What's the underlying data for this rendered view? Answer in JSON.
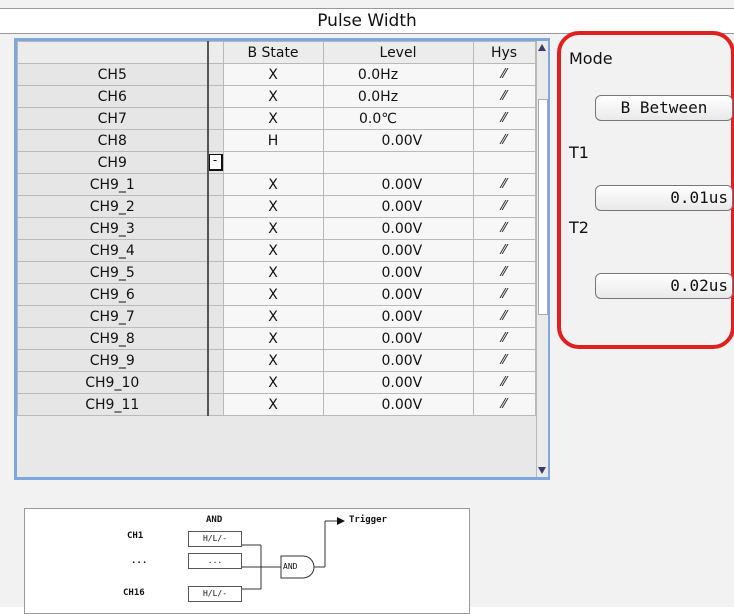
{
  "title": "Pulse Width",
  "table": {
    "headers": {
      "b_state": "B State",
      "level": "Level",
      "hys": "Hys"
    },
    "rows": [
      {
        "name": "CH5",
        "expander": "",
        "bstate": "X",
        "level": "0.0Hz",
        "hys": "⁄⁄",
        "kind": "hz"
      },
      {
        "name": "CH6",
        "expander": "",
        "bstate": "X",
        "level": "0.0Hz",
        "hys": "⁄⁄",
        "kind": "hz"
      },
      {
        "name": "CH7",
        "expander": "",
        "bstate": "X",
        "level": "0.0℃",
        "hys": "⁄⁄",
        "kind": "hz"
      },
      {
        "name": "CH8",
        "expander": "",
        "bstate": "H",
        "level": "0.00V",
        "hys": "⁄⁄",
        "kind": "v"
      },
      {
        "name": "CH9",
        "expander": "-",
        "bstate": "",
        "level": "",
        "hys": "",
        "kind": "v"
      },
      {
        "name": "CH9_1",
        "expander": "",
        "bstate": "X",
        "level": "0.00V",
        "hys": "⁄⁄",
        "kind": "v"
      },
      {
        "name": "CH9_2",
        "expander": "",
        "bstate": "X",
        "level": "0.00V",
        "hys": "⁄⁄",
        "kind": "v"
      },
      {
        "name": "CH9_3",
        "expander": "",
        "bstate": "X",
        "level": "0.00V",
        "hys": "⁄⁄",
        "kind": "v"
      },
      {
        "name": "CH9_4",
        "expander": "",
        "bstate": "X",
        "level": "0.00V",
        "hys": "⁄⁄",
        "kind": "v"
      },
      {
        "name": "CH9_5",
        "expander": "",
        "bstate": "X",
        "level": "0.00V",
        "hys": "⁄⁄",
        "kind": "v"
      },
      {
        "name": "CH9_6",
        "expander": "",
        "bstate": "X",
        "level": "0.00V",
        "hys": "⁄⁄",
        "kind": "v"
      },
      {
        "name": "CH9_7",
        "expander": "",
        "bstate": "X",
        "level": "0.00V",
        "hys": "⁄⁄",
        "kind": "v"
      },
      {
        "name": "CH9_8",
        "expander": "",
        "bstate": "X",
        "level": "0.00V",
        "hys": "⁄⁄",
        "kind": "v"
      },
      {
        "name": "CH9_9",
        "expander": "",
        "bstate": "X",
        "level": "0.00V",
        "hys": "⁄⁄",
        "kind": "v"
      },
      {
        "name": "CH9_10",
        "expander": "",
        "bstate": "X",
        "level": "0.00V",
        "hys": "⁄⁄",
        "kind": "v"
      },
      {
        "name": "CH9_11",
        "expander": "",
        "bstate": "X",
        "level": "0.00V",
        "hys": "⁄⁄",
        "kind": "v"
      }
    ]
  },
  "panel": {
    "mode_label": "Mode",
    "mode_value": "B Between",
    "t1_label": "T1",
    "t1_value": "0.01us",
    "t2_label": "T2",
    "t2_value": "0.02us",
    "highlight_color": "#e02020"
  },
  "diagram": {
    "and_top": "AND",
    "trigger": "Trigger",
    "ch1": "CH1",
    "dots": "...",
    "ch16": "CH16",
    "box1": "H/L/-",
    "box2": "...",
    "box3": "H/L/-",
    "and_gate": "AND"
  }
}
